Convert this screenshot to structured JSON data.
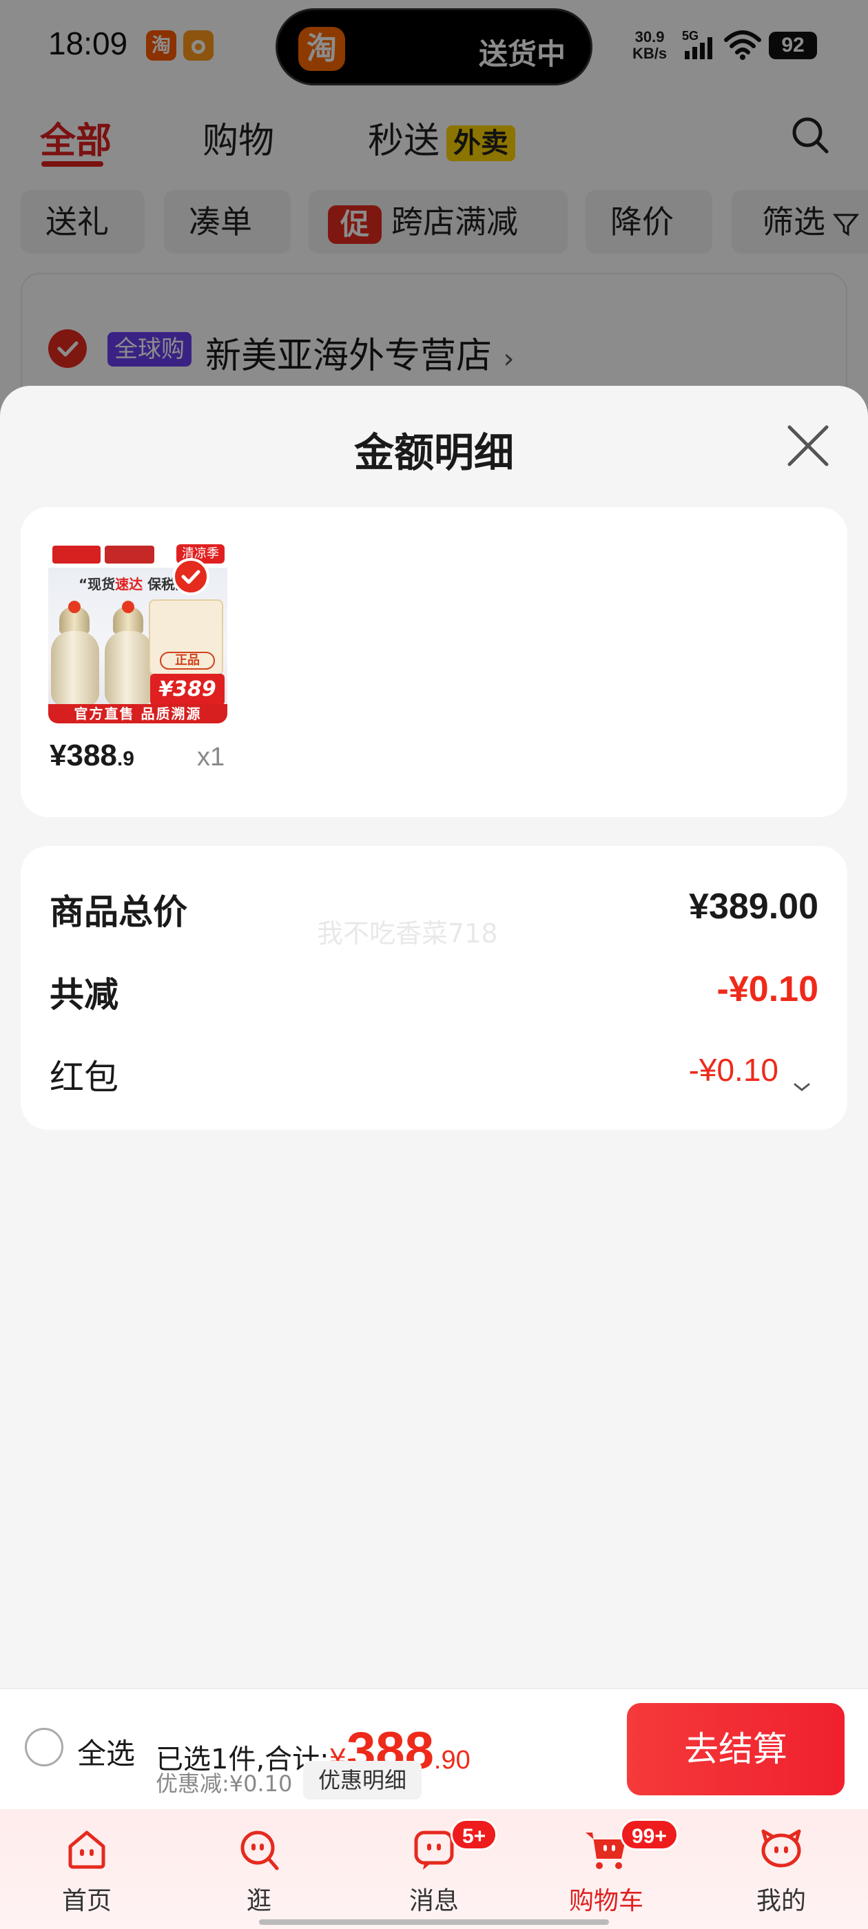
{
  "status_bar": {
    "time": "18:09",
    "app_icon_1": "淘",
    "island_app_icon": "淘",
    "island_text": "送货中",
    "net_speed_value": "30.9",
    "net_speed_unit": "KB/s",
    "network": "5G",
    "battery": "92"
  },
  "top_tabs": {
    "all": "全部",
    "shopping": "购物",
    "flash": "秒送",
    "flash_badge": "外卖"
  },
  "chips": {
    "gift": "送礼",
    "combine": "凑单",
    "promo_icon": "促",
    "cross_store": "跨店满减",
    "price_drop": "降价",
    "filter": "筛选"
  },
  "store": {
    "badge": "全球购",
    "name": "新美亚海外专营店",
    "chevron": "›"
  },
  "sheet": {
    "title": "金额明细"
  },
  "product": {
    "thumb_tag": "清凉季",
    "thumb_slogan_a": "“现货",
    "thumb_slogan_b": "速达",
    "thumb_slogan_c": "保税区",
    "thumb_genuine": "正品",
    "thumb_price": "¥389",
    "thumb_bottom": "官方直售 品质溯源",
    "price_int": "¥388",
    "price_dec": ".9",
    "quantity": "x1"
  },
  "summary": {
    "total_label": "商品总价",
    "total_value": "¥389.00",
    "reduce_label": "共减",
    "reduce_value": "-¥0.10",
    "redpacket_label": "红包",
    "redpacket_value": "-¥0.10",
    "watermark": "我不吃香菜718"
  },
  "checkout": {
    "select_all": "全选",
    "selected_prefix": "已选1件,合计:",
    "currency": "¥",
    "total_int": "388",
    "total_dec": ".90",
    "discount": "优惠减:¥0.10",
    "discount_detail": "优惠明细",
    "checkout_button": "去结算"
  },
  "bottom_nav": {
    "home": "首页",
    "browse": "逛",
    "messages": "消息",
    "messages_badge": "5+",
    "cart": "购物车",
    "cart_badge": "99+",
    "mine": "我的"
  },
  "colors": {
    "accent_red": "#ee2a1a",
    "checkout_red": "#f0202e",
    "global_badge_purple": "#6b3ff0",
    "waimai_yellow": "#ffd400"
  }
}
